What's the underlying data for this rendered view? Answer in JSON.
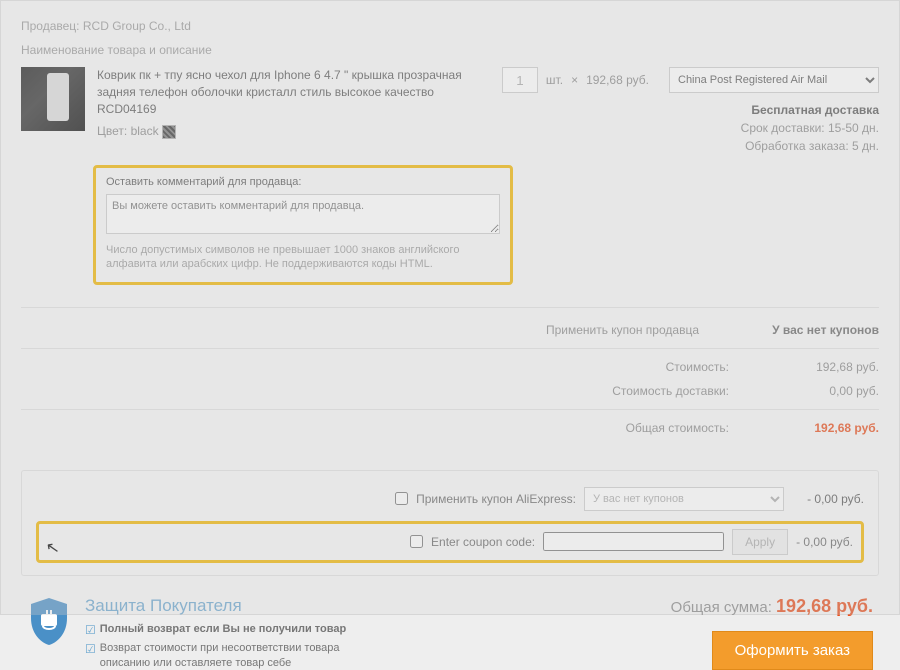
{
  "seller": {
    "prefix": "Продавец:",
    "name": "RCD Group Co., Ltd"
  },
  "desc_label": "Наименование товара и описание",
  "product": {
    "title": "Коврик пк + тпу ясно чехол для Iphone 6 4.7 \" крышка прозрачная задняя телефон оболочки кристалл стиль высокое качество RCD04169",
    "color_label": "Цвет:",
    "color_value": "black"
  },
  "qty": {
    "value": "1",
    "unit": "шт.",
    "times": "×",
    "price": "192,68 руб."
  },
  "shipping": {
    "method": "China Post Registered Air Mail",
    "free": "Бесплатная доставка",
    "time_label": "Срок доставки:",
    "time_value": "15-50 дн.",
    "proc_label": "Обработка заказа:",
    "proc_value": "5 дн."
  },
  "comment": {
    "label": "Оставить комментарий для продавца:",
    "placeholder": "Вы можете оставить комментарий для продавца.",
    "hint": "Число допустимых символов не превышает 1000 знаков английского алфавита или арабских цифр. Не поддерживаются коды HTML."
  },
  "summary": {
    "seller_coupon_label": "Применить купон продавца",
    "seller_coupon_none": "У вас нет купонов",
    "cost_label": "Стоимость:",
    "cost_value": "192,68 руб.",
    "ship_label": "Стоимость доставки:",
    "ship_value": "0,00 руб.",
    "total_label": "Общая стоимость:",
    "total_value": "192,68 руб."
  },
  "coupons": {
    "ali_label": "Применить купон AliExpress:",
    "ali_none": "У вас нет купонов",
    "ali_amount": "- 0,00 руб.",
    "code_label": "Enter coupon code:",
    "apply": "Apply",
    "code_amount": "- 0,00 руб."
  },
  "protection": {
    "title": "Защита Покупателя",
    "line1": "Полный возврат если Вы не получили товар",
    "line2": "Возврат стоимости при несоответствии товара описанию или оставляете товар себе",
    "line2_bold": "Возврат стоимости при несоответствии товара описанию"
  },
  "grand_total": {
    "label": "Общая сумма:",
    "value": "192,68 руб.",
    "button": "Оформить заказ"
  }
}
